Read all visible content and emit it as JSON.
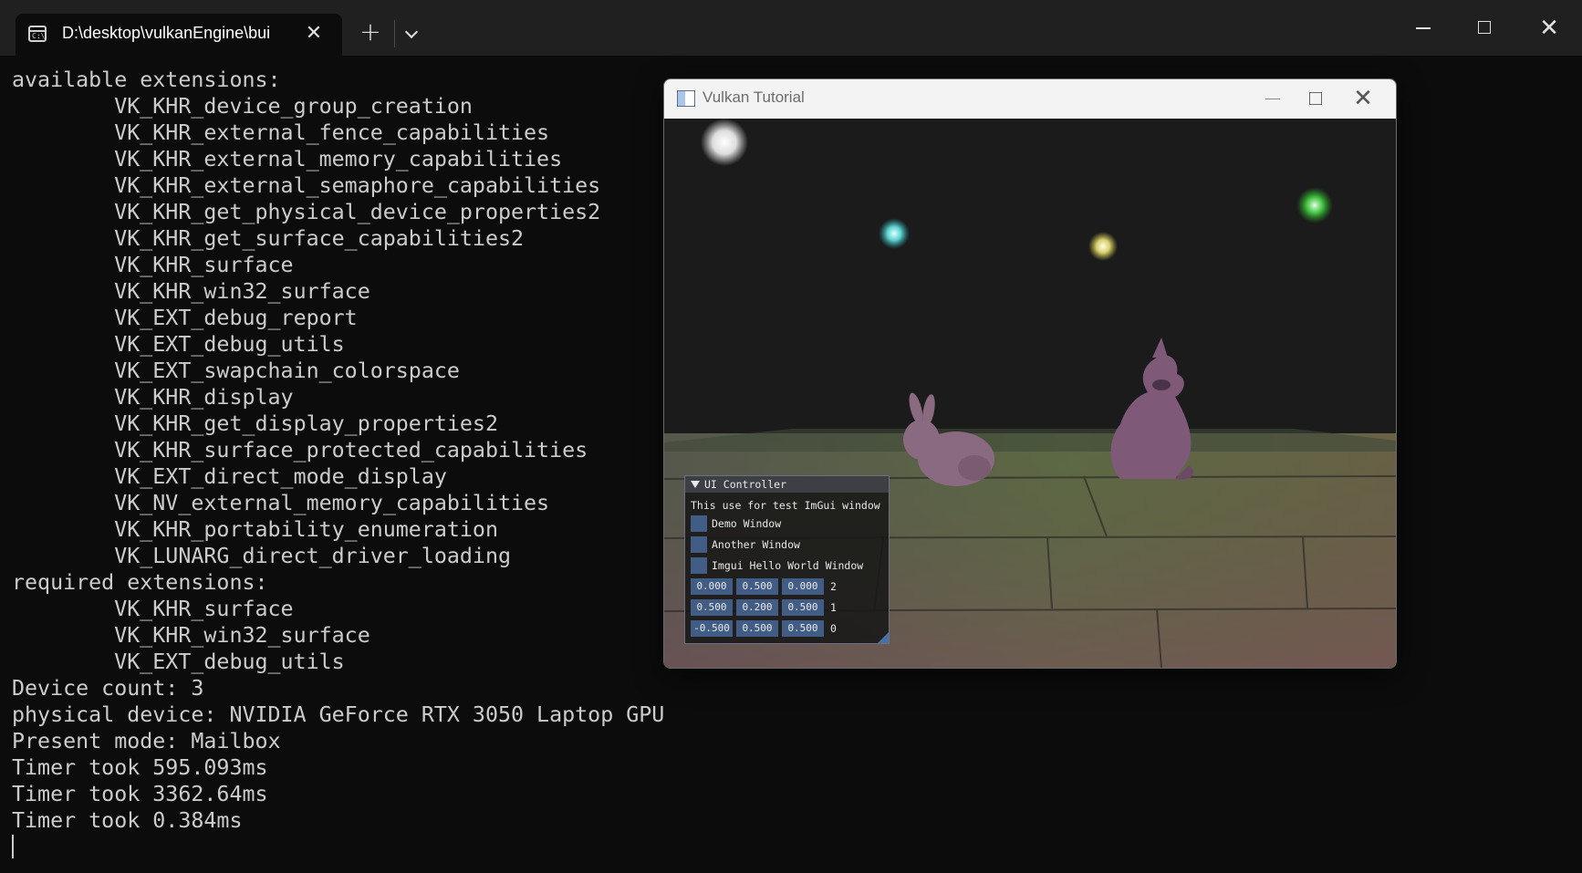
{
  "terminal": {
    "tab_title": "D:\\desktop\\vulkanEngine\\bui",
    "tab_icon": "C:\\",
    "new_tab_label": "+",
    "close_tab_label": "✕",
    "window_close_label": "✕"
  },
  "console": {
    "lines": [
      "available extensions:",
      "        VK_KHR_device_group_creation",
      "        VK_KHR_external_fence_capabilities",
      "        VK_KHR_external_memory_capabilities",
      "        VK_KHR_external_semaphore_capabilities",
      "        VK_KHR_get_physical_device_properties2",
      "        VK_KHR_get_surface_capabilities2",
      "        VK_KHR_surface",
      "        VK_KHR_win32_surface",
      "        VK_EXT_debug_report",
      "        VK_EXT_debug_utils",
      "        VK_EXT_swapchain_colorspace",
      "        VK_KHR_display",
      "        VK_KHR_get_display_properties2",
      "        VK_KHR_surface_protected_capabilities",
      "        VK_EXT_direct_mode_display",
      "        VK_NV_external_memory_capabilities",
      "        VK_KHR_portability_enumeration",
      "        VK_LUNARG_direct_driver_loading",
      "required extensions:",
      "        VK_KHR_surface",
      "        VK_KHR_win32_surface",
      "        VK_EXT_debug_utils",
      "Device count: 3",
      "physical device: NVIDIA GeForce RTX 3050 Laptop GPU",
      "Present mode: Mailbox",
      "Timer took 595.093ms",
      "Timer took 3362.64ms",
      "Timer took 0.384ms"
    ]
  },
  "vulkan_window": {
    "title": "Vulkan Tutorial",
    "close_label": "✕"
  },
  "imgui": {
    "title": "UI Controller",
    "description": "This use for test ImGui window",
    "checkboxes": [
      {
        "label": "Demo Window"
      },
      {
        "label": "Another Window"
      },
      {
        "label": "Imgui Hello World Window"
      }
    ],
    "rows": [
      {
        "values": [
          "0.000",
          "0.500",
          "0.000"
        ],
        "label": "2"
      },
      {
        "values": [
          "0.500",
          "0.200",
          "0.500"
        ],
        "label": "1"
      },
      {
        "values": [
          "-0.500",
          "0.500",
          "0.500"
        ],
        "label": "0"
      }
    ]
  }
}
